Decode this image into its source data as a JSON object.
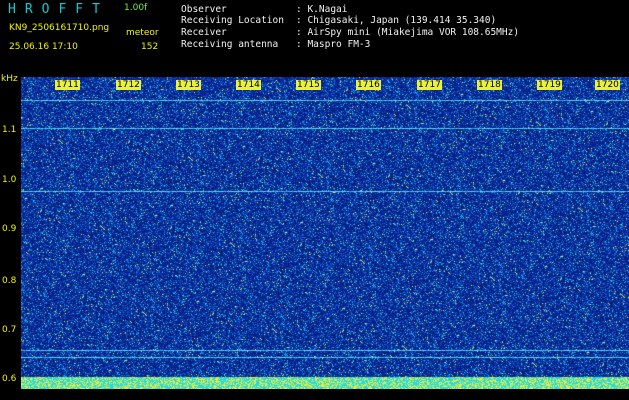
{
  "header": {
    "app_title": "HROFFT",
    "version": "1.00f",
    "filename": "KN9_2506161710.png",
    "datetime": "25.06.16 17:10",
    "mode": "meteor",
    "count": "152"
  },
  "station": {
    "observer_label": "Observer",
    "observer_value": ": K.Nagai",
    "location_label": "Receiving Location",
    "location_value": ": Chigasaki, Japan (139.414 35.340)",
    "receiver_label": "Receiver",
    "receiver_value": ": AirSpy mini (Miakejima VOR 108.65MHz)",
    "antenna_label": "Receiving antenna",
    "antenna_value": ": Maspro FM-3"
  },
  "axis": {
    "unit": "kHz",
    "y_ticks": [
      "1.1",
      "1.0",
      "0.9",
      "0.8",
      "0.7",
      "0.6"
    ],
    "time_labels": [
      "1711",
      "1712",
      "1713",
      "1714",
      "1715",
      "1716",
      "1717",
      "1718",
      "1719",
      "1720"
    ]
  },
  "colors": {
    "background": "#000000",
    "spectrogram_base": "#0a2f9a",
    "noise_cyan": "#1cd6e6",
    "noise_yellow": "#e8f040",
    "label_cyan": "#16c8cf",
    "label_yellow": "#f4f400"
  },
  "chart_data": {
    "type": "heatmap",
    "title": "",
    "xlabel": "",
    "ylabel": "kHz",
    "x_categories": [
      "1711",
      "1712",
      "1713",
      "1714",
      "1715",
      "1716",
      "1717",
      "1718",
      "1719",
      "1720"
    ],
    "y_range_khz": [
      0.57,
      1.16
    ],
    "horizontal_carrier_lines_khz": [
      1.115,
      1.06,
      0.935,
      0.62,
      0.605
    ],
    "grid": false
  }
}
